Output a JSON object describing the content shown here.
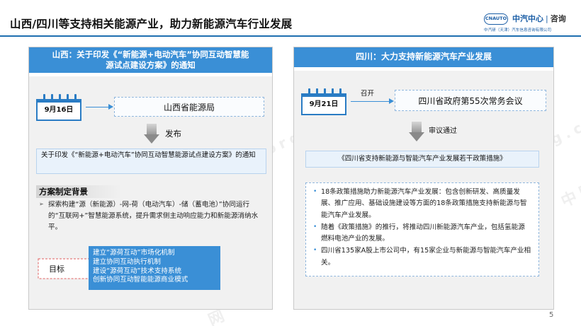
{
  "title": "山西/四川等支持相关能源产业，助力新能源汽车行业发展",
  "logo": {
    "mark": "CNAUTO",
    "name": "中汽中心",
    "alt_name": "咨询",
    "subtitle": "中汽研（天津）汽车信息咨询有限公司"
  },
  "left": {
    "header": "山西：关于印发《“新能源+电动汽车”协同互动智慧能源试点建设方案》的通知",
    "date": "9月16日",
    "agency": "山西省能源局",
    "arrow_label": "发布",
    "notice": "关于印发《“新能源+电动汽车”协同互动智慧能源试点建设方案》的通知",
    "background_title": "方案制定背景",
    "background_bullet": "➢",
    "background_text": "探索构建“源（新能源）-网-荷（电动汽车）-储（蓄电池）”协同运行的“互联网+”智慧能源系统，提升需求侧主动响应能力和新能源消纳水平。",
    "goal_label": "目标",
    "goals": [
      "建立“源荷互动”市场化机制",
      "建立协同互动执行机制",
      "建设“源荷互动”技术支持系统",
      "创新协同互动智能能源商业模式"
    ]
  },
  "right": {
    "header": "四川：大力支持新能源汽车产业发展",
    "date": "9月21日",
    "meeting_label": "召开",
    "meeting": "四川省政府第55次常务会议",
    "arrow_label": "审议通过",
    "policy": "《四川省支持新能源与智能汽车产业发展若干政策措施》",
    "bullet": "•",
    "items": [
      "18条政策措施助力新能源汽车产业发展：包含创新研发、高质量发展、推广应用、基础设施建设等方面的18条政策措施支持新能源与智能汽车产业发展。",
      "随着《政策措施》的推行，将推动四川新能源汽车产业，包括氢能源燃料电池产业的发展。",
      "四川省135家A股上市公司中，有15家企业与新能源与智能汽车产业相关。"
    ]
  },
  "watermarks": [
    "中国汽车工业信息网",
    "www.autoinfo.org.cn",
    "中国汽车工业信息网",
    "www.autoinfo.org.cn",
    "中国",
    "网"
  ],
  "page_number": "5",
  "colors": {
    "accent": "#3a8fd6",
    "title_rule": "#1e6fb0",
    "panel_bg": "#f1f1f1"
  }
}
